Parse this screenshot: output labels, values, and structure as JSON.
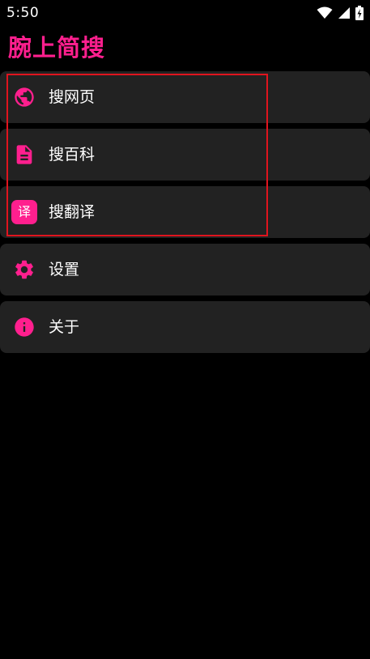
{
  "status_bar": {
    "time": "5:50",
    "icons": [
      "wifi-icon",
      "signal-icon",
      "battery-charging-icon"
    ]
  },
  "app": {
    "title": "腕上简搜"
  },
  "menu": {
    "items": [
      {
        "label": "搜网页",
        "icon": "globe-icon"
      },
      {
        "label": "搜百科",
        "icon": "document-icon"
      },
      {
        "label": "搜翻译",
        "icon": "translate-icon",
        "icon_text": "译"
      },
      {
        "label": "设置",
        "icon": "gear-icon"
      },
      {
        "label": "关于",
        "icon": "info-icon"
      }
    ]
  },
  "colors": {
    "accent": "#ff1f8e",
    "card_background": "#222222",
    "page_background": "#000000",
    "highlight_border": "#e0141e"
  }
}
